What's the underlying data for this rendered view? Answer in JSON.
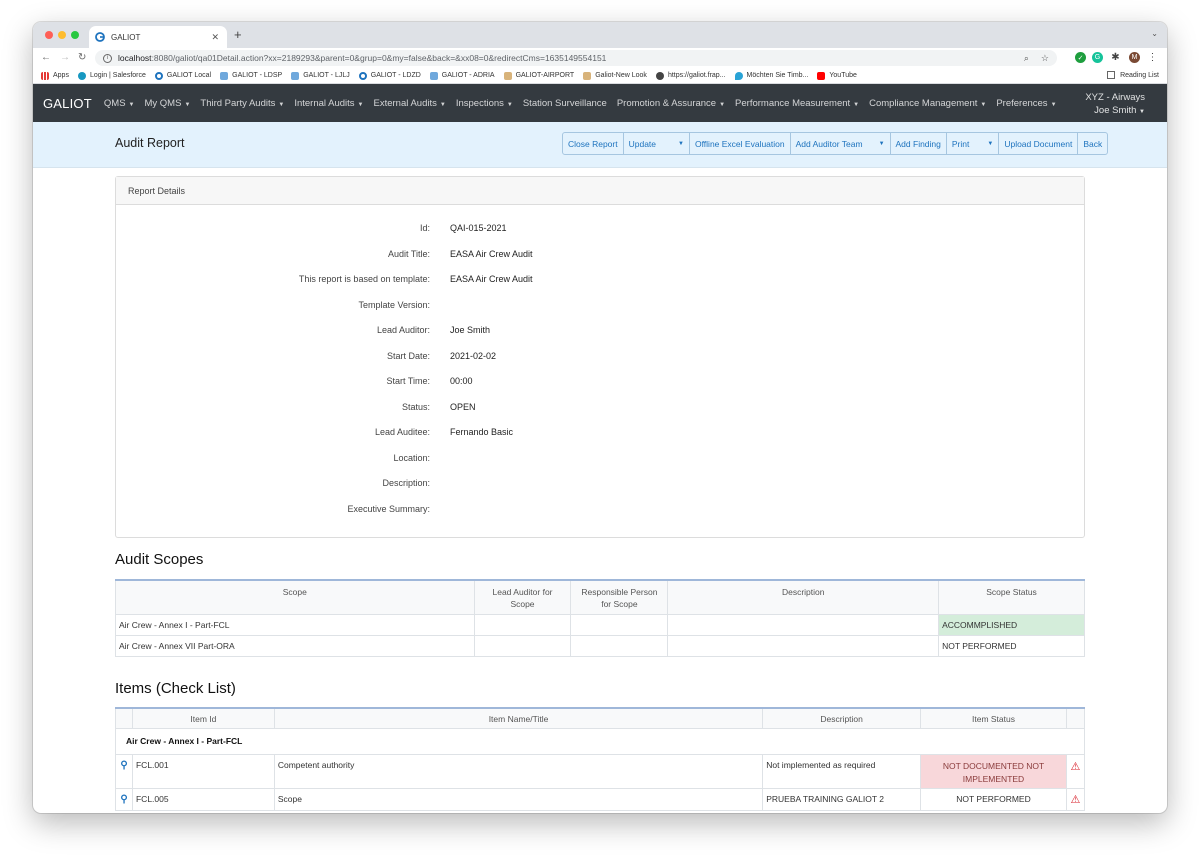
{
  "browser": {
    "tab_title": "GALIOT",
    "url_host": "localhost",
    "url_rest": ":8080/galiot/qa01Detail.action?xx=2189293&parent=0&grup=0&my=false&back=&xx08=0&redirectCms=1635149554151",
    "bookmarks": [
      "Apps",
      "Login | Salesforce",
      "GALIOT Local",
      "GALIOT - LDSP",
      "GALIOT - LJLJ",
      "GALIOT - LDZD",
      "GALIOT - ADRIA",
      "GALIOT-AIRPORT",
      "Galiot-New Look",
      "https://galiot.frap...",
      "Möchten Sie Timb...",
      "YouTube"
    ],
    "reading_list": "Reading List",
    "profile_initial": "M"
  },
  "navbar": {
    "brand": "GALIOT",
    "items": [
      "QMS",
      "My QMS",
      "Third Party Audits",
      "Internal Audits",
      "External Audits",
      "Inspections",
      "Station Surveillance",
      "Promotion & Assurance",
      "Performance Measurement",
      "Compliance Management",
      "Preferences"
    ],
    "org": "XYZ - Airways",
    "user": "Joe Smith"
  },
  "header": {
    "title": "Audit Report",
    "buttons": {
      "close_report": "Close Report",
      "update": "Update",
      "offline_excel": "Offline Excel Evaluation",
      "add_auditor_team": "Add Auditor Team",
      "add_finding": "Add Finding",
      "print": "Print",
      "upload_document": "Upload Document",
      "back": "Back"
    }
  },
  "details": {
    "card_title": "Report Details",
    "fields": [
      {
        "label": "Id:",
        "value": "QAI-015-2021"
      },
      {
        "label": "Audit Title:",
        "value": "EASA Air Crew Audit"
      },
      {
        "label": "This report is based on template:",
        "value": "EASA Air Crew Audit"
      },
      {
        "label": "Template Version:",
        "value": ""
      },
      {
        "label": "Lead Auditor:",
        "value": "Joe Smith"
      },
      {
        "label": "Start Date:",
        "value": "2021-02-02"
      },
      {
        "label": "Start Time:",
        "value": "00:00"
      },
      {
        "label": "Status:",
        "value": "OPEN"
      },
      {
        "label": "Lead Auditee:",
        "value": "Fernando Basic"
      },
      {
        "label": "Location:",
        "value": ""
      },
      {
        "label": "Description:",
        "value": ""
      },
      {
        "label": "Executive Summary:",
        "value": ""
      }
    ]
  },
  "scopes": {
    "title": "Audit Scopes",
    "columns": {
      "scope": "Scope",
      "lead_auditor_1": "Lead Auditor for",
      "lead_auditor_2": "Scope",
      "responsible_1": "Responsible Person",
      "responsible_2": "for Scope",
      "description": "Description",
      "status": "Scope Status"
    },
    "rows": [
      {
        "scope": "Air Crew - Annex I - Part-FCL",
        "lead": "",
        "responsible": "",
        "description": "",
        "status": "ACCOMMPLISHED"
      },
      {
        "scope": "Air Crew - Annex VII Part-ORA",
        "lead": "",
        "responsible": "",
        "description": "",
        "status": "NOT PERFORMED"
      }
    ]
  },
  "items": {
    "title": "Items (Check List)",
    "columns": {
      "id": "Item Id",
      "name": "Item Name/Title",
      "description": "Description",
      "status": "Item Status"
    },
    "group": "Air Crew - Annex I - Part-FCL",
    "rows": [
      {
        "id": "FCL.001",
        "name": "Competent authority",
        "description": "Not implemented as required",
        "status_1": "NOT DOCUMENTED NOT",
        "status_2": "IMPLEMENTED"
      },
      {
        "id": "FCL.005",
        "name": "Scope",
        "description": "PRUEBA TRAINING GALIOT 2",
        "status": "NOT PERFORMED"
      }
    ]
  },
  "colors": {
    "navbar_bg": "#343a40",
    "header_bg": "#e3f2fd",
    "link_blue": "#1e73be",
    "success_bg": "#d4edda",
    "danger_bg": "#f8d7da",
    "warning_red": "#d9232d"
  }
}
